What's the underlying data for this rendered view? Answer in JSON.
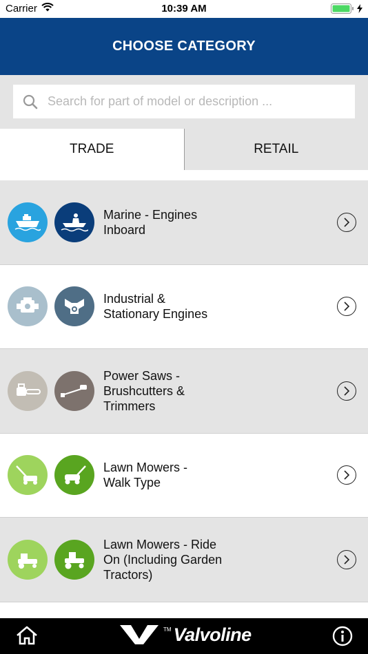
{
  "status": {
    "carrier": "Carrier",
    "time": "10:39 AM"
  },
  "header": {
    "title": "CHOOSE CATEGORY"
  },
  "search": {
    "placeholder": "Search for part of model or description ..."
  },
  "tabs": [
    {
      "label": "TRADE",
      "active": true
    },
    {
      "label": "RETAIL",
      "active": false
    }
  ],
  "categories": [
    {
      "label": "Marine - Engines\nInboard",
      "icon1": "speedboat-icon",
      "icon2": "boat-driver-icon",
      "color1": "#29a3df",
      "color2": "#0a3d7a"
    },
    {
      "label": "Industrial &\nStationary Engines",
      "icon1": "engine-icon",
      "icon2": "v-engine-icon",
      "color1": "#a9bfcc",
      "color2": "#4f6e86"
    },
    {
      "label": "Power Saws -\nBrushcutters &\nTrimmers",
      "icon1": "chainsaw-icon",
      "icon2": "trimmer-icon",
      "color1": "#c2bdb4",
      "color2": "#7d726d"
    },
    {
      "label": "Lawn Mowers -\nWalk Type",
      "icon1": "push-mower-icon",
      "icon2": "walk-mower-icon",
      "color1": "#9ed45d",
      "color2": "#59a520"
    },
    {
      "label": "Lawn Mowers - Ride\nOn (Including Garden\nTractors)",
      "icon1": "ride-on-mower-icon",
      "icon2": "garden-tractor-icon",
      "color1": "#9ed45d",
      "color2": "#59a520"
    }
  ],
  "footer": {
    "brand": "Valvoline",
    "tm": "TM",
    "home_icon": "home-icon",
    "info_icon": "info-icon"
  },
  "colors": {
    "header": "#0a4487",
    "shaded_row": "#e4e4e4",
    "footer": "#000000"
  }
}
